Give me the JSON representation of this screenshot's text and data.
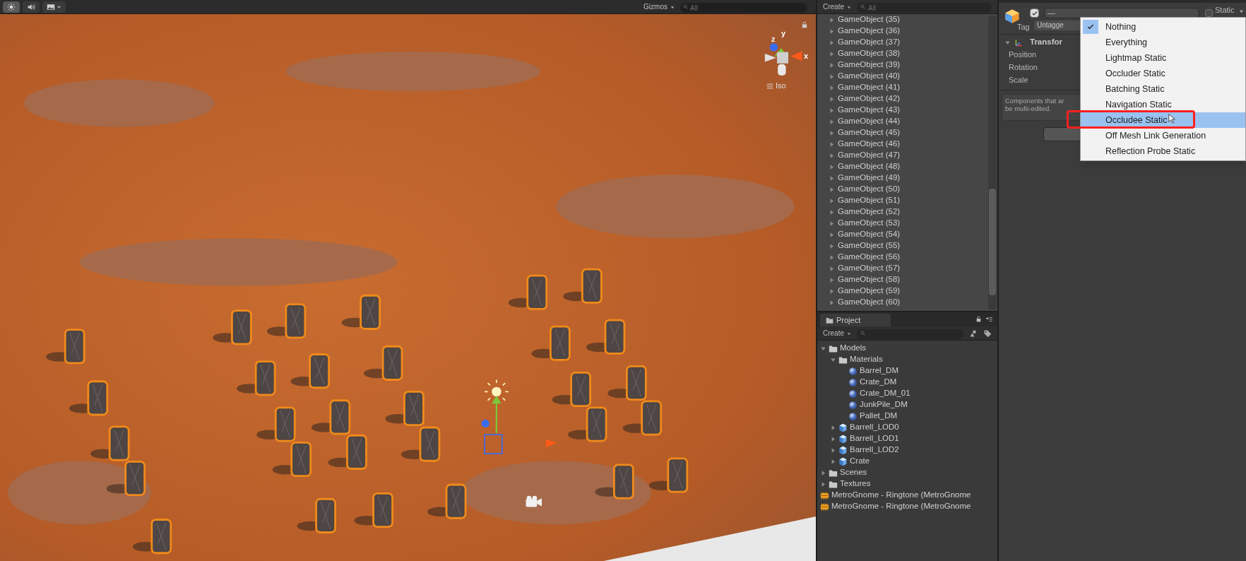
{
  "scene_view": {
    "toolbar": {
      "buttons": [
        {
          "kind": "light",
          "selected": true
        },
        {
          "kind": "audio",
          "selected": false
        },
        {
          "kind": "effects",
          "selected": false
        }
      ],
      "gizmos_label": "Gizmos",
      "search_placeholder": "All"
    },
    "orientation_gizmo": {
      "axes": [
        "x",
        "y",
        "z"
      ],
      "projection": "Iso"
    }
  },
  "hierarchy": {
    "create_label": "Create",
    "search_placeholder": "All",
    "items": [
      {
        "label": "GameObject (35)",
        "expanded": false
      },
      {
        "label": "GameObject (36)",
        "expanded": false
      },
      {
        "label": "GameObject (37)",
        "expanded": false
      },
      {
        "label": "GameObject (38)",
        "expanded": false
      },
      {
        "label": "GameObject (39)",
        "expanded": false
      },
      {
        "label": "GameObject (40)",
        "expanded": false
      },
      {
        "label": "GameObject (41)",
        "expanded": false
      },
      {
        "label": "GameObject (42)",
        "expanded": false
      },
      {
        "label": "GameObject (43)",
        "expanded": false
      },
      {
        "label": "GameObject (44)",
        "expanded": false
      },
      {
        "label": "GameObject (45)",
        "expanded": false
      },
      {
        "label": "GameObject (46)",
        "expanded": false
      },
      {
        "label": "GameObject (47)",
        "expanded": false
      },
      {
        "label": "GameObject (48)",
        "expanded": false
      },
      {
        "label": "GameObject (49)",
        "expanded": false
      },
      {
        "label": "GameObject (50)",
        "expanded": false
      },
      {
        "label": "GameObject (51)",
        "expanded": false
      },
      {
        "label": "GameObject (52)",
        "expanded": false
      },
      {
        "label": "GameObject (53)",
        "expanded": false
      },
      {
        "label": "GameObject (54)",
        "expanded": false
      },
      {
        "label": "GameObject (55)",
        "expanded": false
      },
      {
        "label": "GameObject (56)",
        "expanded": false
      },
      {
        "label": "GameObject (57)",
        "expanded": false
      },
      {
        "label": "GameObject (58)",
        "expanded": false
      },
      {
        "label": "GameObject (59)",
        "expanded": false
      },
      {
        "label": "GameObject (60)",
        "expanded": false
      }
    ]
  },
  "project": {
    "tab": "Project",
    "create_label": "Create",
    "tree": [
      {
        "kind": "folder",
        "label": "Models",
        "expanded": true,
        "children": [
          {
            "kind": "folder",
            "label": "Materials",
            "expanded": true,
            "children": [
              {
                "kind": "material",
                "label": "Barrel_DM"
              },
              {
                "kind": "material",
                "label": "Crate_DM"
              },
              {
                "kind": "material",
                "label": "Crate_DM_01"
              },
              {
                "kind": "material",
                "label": "JunkPile_DM"
              },
              {
                "kind": "material",
                "label": "Pallet_DM"
              }
            ]
          },
          {
            "kind": "model",
            "label": "Barrell_LOD0",
            "expanded": false
          },
          {
            "kind": "model",
            "label": "Barrell_LOD1",
            "expanded": false
          },
          {
            "kind": "model",
            "label": "Barrell_LOD2",
            "expanded": false
          },
          {
            "kind": "model",
            "label": "Crate",
            "expanded": false
          }
        ]
      },
      {
        "kind": "folder",
        "label": "Scenes",
        "expanded": false
      },
      {
        "kind": "folder",
        "label": "Textures",
        "expanded": false
      },
      {
        "kind": "audio",
        "label": "MetroGnome - Ringtone (MetroGnome"
      },
      {
        "kind": "audio",
        "label": "MetroGnome - Ringtone (MetroGnome"
      }
    ]
  },
  "inspector": {
    "active": true,
    "name": "—",
    "static": false,
    "static_label": "Static",
    "tag_label": "Tag",
    "tag": "Untagge",
    "component": {
      "title": "Transfor",
      "expanded": true,
      "fields": [
        "Position",
        "Rotation",
        "Scale"
      ]
    },
    "help_lines": [
      "Components that ar",
      "be multi-edited."
    ]
  },
  "static_menu": {
    "items": [
      {
        "label": "Nothing",
        "checked": true,
        "selected": false
      },
      {
        "label": "Everything",
        "checked": false,
        "selected": false
      },
      {
        "label": "Lightmap Static",
        "checked": false,
        "selected": false
      },
      {
        "label": "Occluder Static",
        "checked": false,
        "selected": false
      },
      {
        "label": "Batching Static",
        "checked": false,
        "selected": false
      },
      {
        "label": "Navigation Static",
        "checked": false,
        "selected": false
      },
      {
        "label": "Occludee Static",
        "checked": false,
        "selected": true
      },
      {
        "label": "Off Mesh Link Generation",
        "checked": false,
        "selected": false
      },
      {
        "label": "Reflection Probe Static",
        "checked": false,
        "selected": false
      }
    ]
  }
}
